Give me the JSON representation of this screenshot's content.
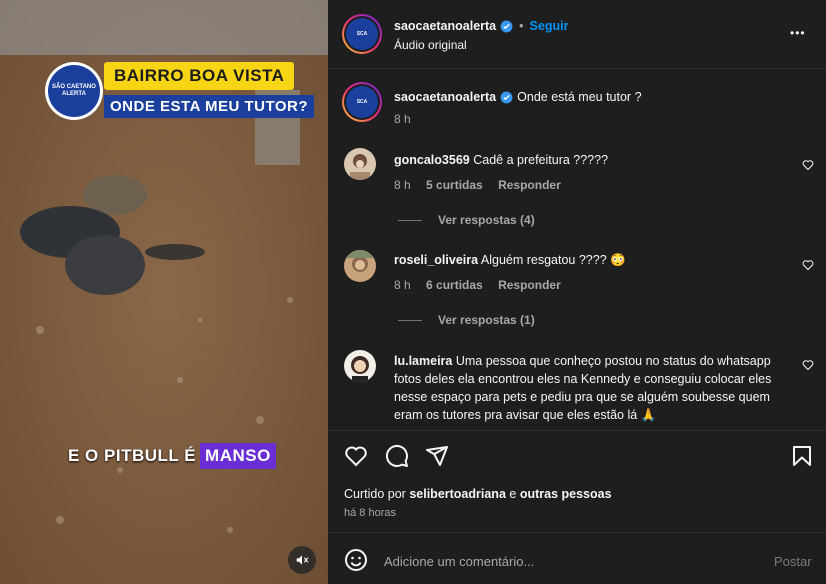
{
  "video": {
    "logo_text": "SÃO CAETANO ALERTA",
    "banner_line1": "BAIRRO BOA VISTA",
    "banner_line2": "ONDE ESTA MEU TUTOR?",
    "caption_part1": "E O PITBULL É",
    "caption_part2": "MANSO"
  },
  "header": {
    "username": "saocaetanoalerta",
    "follow": "Seguir",
    "subtitle": "Áudio original",
    "more": "•••"
  },
  "post": {
    "username": "saocaetanoalerta",
    "text": "Onde está meu tutor ?",
    "time": "8 h"
  },
  "comments": [
    {
      "username": "goncalo3569",
      "text": "Cadê a prefeitura ?????",
      "time": "8 h",
      "likes": "5 curtidas",
      "reply": "Responder",
      "view_replies": "Ver respostas (4)"
    },
    {
      "username": "roseli_oliveira",
      "text": "Alguém resgatou ???? 😳",
      "time": "8 h",
      "likes": "6 curtidas",
      "reply": "Responder",
      "view_replies": "Ver respostas (1)"
    },
    {
      "username": "lu.lameira",
      "text": "Uma pessoa que conheço postou no status do whatsapp fotos deles ela encontrou eles na Kennedy e conseguiu colocar eles nesse espaço para pets e pediu pra que se alguém soubesse quem eram os tutores pra avisar que eles estão lá 🙏"
    }
  ],
  "footer": {
    "liked_prefix": "Curtido por",
    "liked_user": "selibertoadriana",
    "liked_and": "e",
    "liked_others": "outras pessoas",
    "time": "há 8 horas",
    "comment_placeholder": "Adicione um comentário...",
    "post_button": "Postar"
  },
  "colors": {
    "accent": "#0095f6",
    "verified": "#3897f0",
    "banner_yellow": "#f7d514",
    "caption_purple": "#6a2fd4"
  }
}
